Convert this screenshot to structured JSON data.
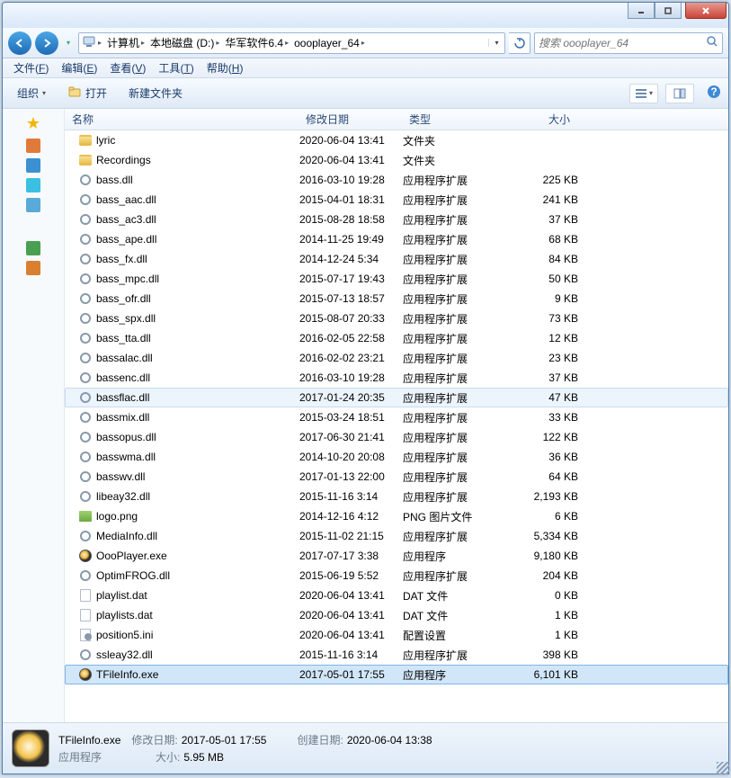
{
  "breadcrumb": [
    "计算机",
    "本地磁盘 (D:)",
    "华军软件6.4",
    "oooplayer_64"
  ],
  "search": {
    "placeholder": "搜索 oooplayer_64"
  },
  "menubar": {
    "file": {
      "label": "文件",
      "hot": "F"
    },
    "edit": {
      "label": "编辑",
      "hot": "E"
    },
    "view": {
      "label": "查看",
      "hot": "V"
    },
    "tools": {
      "label": "工具",
      "hot": "T"
    },
    "help": {
      "label": "帮助",
      "hot": "H"
    }
  },
  "toolbar": {
    "organize": "组织",
    "open": "打开",
    "newfolder": "新建文件夹"
  },
  "columns": {
    "name": "名称",
    "date": "修改日期",
    "type": "类型",
    "size": "大小"
  },
  "rows": [
    {
      "icon": "folder",
      "name": "lyric",
      "date": "2020-06-04 13:41",
      "type": "文件夹",
      "size": ""
    },
    {
      "icon": "folder",
      "name": "Recordings",
      "date": "2020-06-04 13:41",
      "type": "文件夹",
      "size": ""
    },
    {
      "icon": "dll",
      "name": "bass.dll",
      "date": "2016-03-10 19:28",
      "type": "应用程序扩展",
      "size": "225 KB"
    },
    {
      "icon": "dll",
      "name": "bass_aac.dll",
      "date": "2015-04-01 18:31",
      "type": "应用程序扩展",
      "size": "241 KB"
    },
    {
      "icon": "dll",
      "name": "bass_ac3.dll",
      "date": "2015-08-28 18:58",
      "type": "应用程序扩展",
      "size": "37 KB"
    },
    {
      "icon": "dll",
      "name": "bass_ape.dll",
      "date": "2014-11-25 19:49",
      "type": "应用程序扩展",
      "size": "68 KB"
    },
    {
      "icon": "dll",
      "name": "bass_fx.dll",
      "date": "2014-12-24 5:34",
      "type": "应用程序扩展",
      "size": "84 KB"
    },
    {
      "icon": "dll",
      "name": "bass_mpc.dll",
      "date": "2015-07-17 19:43",
      "type": "应用程序扩展",
      "size": "50 KB"
    },
    {
      "icon": "dll",
      "name": "bass_ofr.dll",
      "date": "2015-07-13 18:57",
      "type": "应用程序扩展",
      "size": "9 KB"
    },
    {
      "icon": "dll",
      "name": "bass_spx.dll",
      "date": "2015-08-07 20:33",
      "type": "应用程序扩展",
      "size": "73 KB"
    },
    {
      "icon": "dll",
      "name": "bass_tta.dll",
      "date": "2016-02-05 22:58",
      "type": "应用程序扩展",
      "size": "12 KB"
    },
    {
      "icon": "dll",
      "name": "bassalac.dll",
      "date": "2016-02-02 23:21",
      "type": "应用程序扩展",
      "size": "23 KB"
    },
    {
      "icon": "dll",
      "name": "bassenc.dll",
      "date": "2016-03-10 19:28",
      "type": "应用程序扩展",
      "size": "37 KB"
    },
    {
      "icon": "dll",
      "name": "bassflac.dll",
      "date": "2017-01-24 20:35",
      "type": "应用程序扩展",
      "size": "47 KB",
      "hover": true
    },
    {
      "icon": "dll",
      "name": "bassmix.dll",
      "date": "2015-03-24 18:51",
      "type": "应用程序扩展",
      "size": "33 KB"
    },
    {
      "icon": "dll",
      "name": "bassopus.dll",
      "date": "2017-06-30 21:41",
      "type": "应用程序扩展",
      "size": "122 KB"
    },
    {
      "icon": "dll",
      "name": "basswma.dll",
      "date": "2014-10-20 20:08",
      "type": "应用程序扩展",
      "size": "36 KB"
    },
    {
      "icon": "dll",
      "name": "basswv.dll",
      "date": "2017-01-13 22:00",
      "type": "应用程序扩展",
      "size": "64 KB"
    },
    {
      "icon": "dll",
      "name": "libeay32.dll",
      "date": "2015-11-16 3:14",
      "type": "应用程序扩展",
      "size": "2,193 KB"
    },
    {
      "icon": "png",
      "name": "logo.png",
      "date": "2014-12-16 4:12",
      "type": "PNG 图片文件",
      "size": "6 KB"
    },
    {
      "icon": "dll",
      "name": "MediaInfo.dll",
      "date": "2015-11-02 21:15",
      "type": "应用程序扩展",
      "size": "5,334 KB"
    },
    {
      "icon": "exe",
      "name": "OooPlayer.exe",
      "date": "2017-07-17 3:38",
      "type": "应用程序",
      "size": "9,180 KB"
    },
    {
      "icon": "dll",
      "name": "OptimFROG.dll",
      "date": "2015-06-19 5:52",
      "type": "应用程序扩展",
      "size": "204 KB"
    },
    {
      "icon": "dat",
      "name": "playlist.dat",
      "date": "2020-06-04 13:41",
      "type": "DAT 文件",
      "size": "0 KB"
    },
    {
      "icon": "dat",
      "name": "playlists.dat",
      "date": "2020-06-04 13:41",
      "type": "DAT 文件",
      "size": "1 KB"
    },
    {
      "icon": "ini",
      "name": "position5.ini",
      "date": "2020-06-04 13:41",
      "type": "配置设置",
      "size": "1 KB"
    },
    {
      "icon": "dll",
      "name": "ssleay32.dll",
      "date": "2015-11-16 3:14",
      "type": "应用程序扩展",
      "size": "398 KB"
    },
    {
      "icon": "exe",
      "name": "TFileInfo.exe",
      "date": "2017-05-01 17:55",
      "type": "应用程序",
      "size": "6,101 KB",
      "selected": true
    }
  ],
  "status": {
    "filename": "TFileInfo.exe",
    "typelabel": "应用程序",
    "moddate_label": "修改日期:",
    "moddate": "2017-05-01 17:55",
    "size_label": "大小:",
    "size": "5.95 MB",
    "crdate_label": "创建日期:",
    "crdate": "2020-06-04 13:38"
  }
}
